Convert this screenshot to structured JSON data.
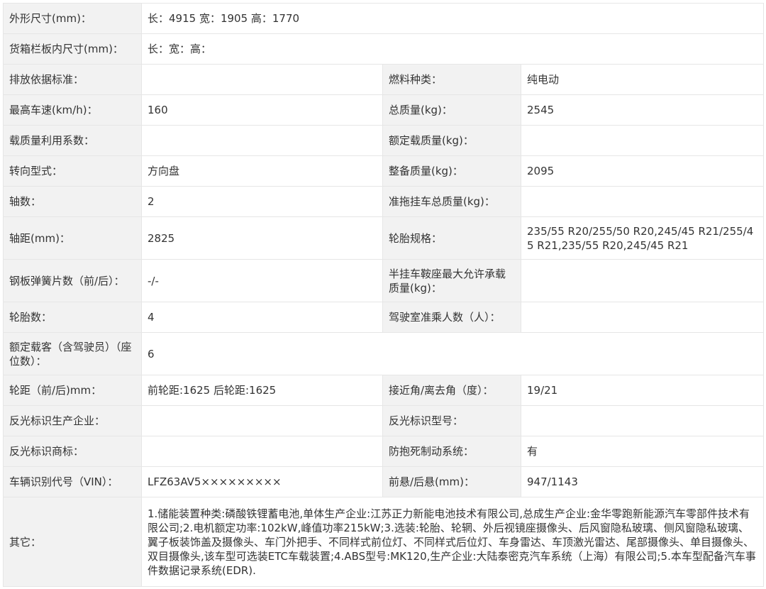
{
  "rows": [
    {
      "l1": "外形尺寸(mm)：",
      "v1": "长：4915 宽：1905 高：1770"
    },
    {
      "l1": "货箱栏板内尺寸(mm)：",
      "v1": "长：宽：高："
    },
    {
      "l1": "排放依据标准：",
      "v1": "",
      "l2": "燃料种类：",
      "v2": "纯电动"
    },
    {
      "l1": "最高车速(km/h)：",
      "v1": "160",
      "l2": "总质量(kg)：",
      "v2": "2545"
    },
    {
      "l1": "载质量利用系数：",
      "v1": "",
      "l2": "额定载质量(kg)：",
      "v2": ""
    },
    {
      "l1": "转向型式：",
      "v1": "方向盘",
      "l2": "整备质量(kg)：",
      "v2": "2095"
    },
    {
      "l1": "轴数：",
      "v1": "2",
      "l2": "准拖挂车总质量(kg)：",
      "v2": ""
    },
    {
      "l1": "轴距(mm)：",
      "v1": "2825",
      "l2": "轮胎规格：",
      "v2": "235/55 R20/255/50 R20,245/45 R21/255/45 R21,235/55 R20,245/45 R21"
    },
    {
      "l1": "钢板弹簧片数（前/后）：",
      "v1": "-/-",
      "l2": "半挂车鞍座最大允许承载质量(kg)：",
      "v2": ""
    },
    {
      "l1": "轮胎数：",
      "v1": "4",
      "l2": "驾驶室准乘人数（人）：",
      "v2": ""
    },
    {
      "l1": "额定载客（含驾驶员）（座位数）：",
      "v1": "6"
    },
    {
      "l1": "轮距（前/后)mm：",
      "v1": "前轮距:1625 后轮距:1625",
      "l2": "接近角/离去角（度）：",
      "v2": "19/21"
    },
    {
      "l1": "反光标识生产企业：",
      "v1": "",
      "l2": "反光标识型号：",
      "v2": ""
    },
    {
      "l1": "反光标识商标：",
      "v1": "",
      "l2": "防抱死制动系统：",
      "v2": "有"
    },
    {
      "l1": "车辆识别代号（VIN）：",
      "v1": "LFZ63AV5×××××××××",
      "l2": "前悬/后悬(mm)：",
      "v2": "947/1143"
    },
    {
      "l1": "其它：",
      "v1": "1.储能装置种类:磷酸铁锂蓄电池,单体生产企业:江苏正力新能电池技术有限公司,总成生产企业:金华零跑新能源汽车零部件技术有限公司;2.电机额定功率:102kW,峰值功率215kW;3.选装:轮胎、轮辋、外后视镜座摄像头、后风窗隐私玻璃、侧风窗隐私玻璃、翼子板装饰盖及摄像头、车门外把手、不同样式前位灯、不同样式后位灯、车身雷达、车顶激光雷达、尾部摄像头、单目摄像头、双目摄像头,该车型可选装ETC车载装置;4.ABS型号:MK120,生产企业:大陆泰密克汽车系统（上海）有限公司;5.本车型配备汽车事件数据记录系统(EDR)."
    }
  ]
}
